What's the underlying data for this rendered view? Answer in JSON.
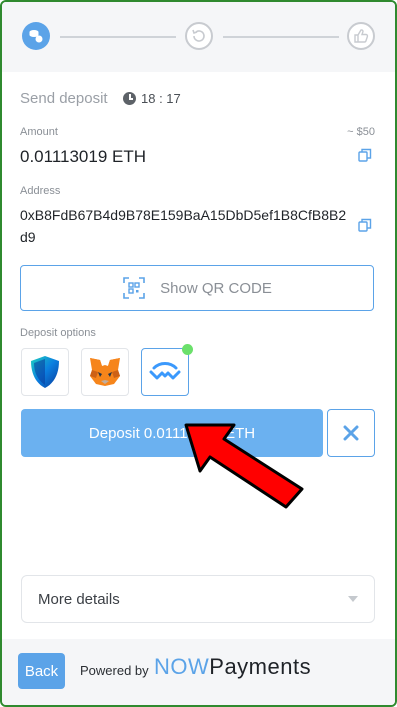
{
  "send": {
    "title": "Send deposit",
    "timer": "18 : 17"
  },
  "amount": {
    "label": "Amount",
    "value": "0.01113019 ETH",
    "usd": "~ $50"
  },
  "address": {
    "label": "Address",
    "value": "0xB8FdB67B4d9B78E159BaA15DbD5ef1B8CfB8B2d9"
  },
  "qr": {
    "label": "Show QR CODE"
  },
  "deposit_options": {
    "label": "Deposit options",
    "wallets": [
      "trust-wallet",
      "metamask",
      "walletconnect"
    ]
  },
  "deposit_button": {
    "label": "Deposit 0.01113019 ETH"
  },
  "details": {
    "label": "More details"
  },
  "footer": {
    "back": "Back",
    "powered": "Powered by",
    "brand_now": "NOW",
    "brand_payments": "Payments"
  },
  "colors": {
    "accent": "#5ba3e8",
    "button": "#6bb1f0",
    "arrow": "#ff0000",
    "online": "#6be06b",
    "frame": "#2f8a2f"
  }
}
